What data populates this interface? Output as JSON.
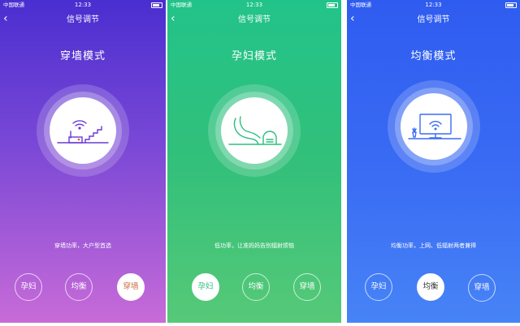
{
  "status": {
    "carrier": "中国联通",
    "time": "12:33"
  },
  "nav": {
    "title": "信号调节",
    "back": "‹"
  },
  "screens": [
    {
      "mode": "穿墙模式",
      "description": "穿墙功率，大户型首选",
      "buttons": [
        "孕妇",
        "均衡",
        "穿墙"
      ],
      "active": 2
    },
    {
      "mode": "孕妇模式",
      "description": "低功率，让准妈妈告别辐射烦恼",
      "buttons": [
        "孕妇",
        "均衡",
        "穿墙"
      ],
      "active": 0
    },
    {
      "mode": "均衡模式",
      "description": "均衡功率，上网、低辐射两者兼得",
      "buttons": [
        "孕妇",
        "均衡",
        "穿墙"
      ],
      "active": 1
    }
  ],
  "colors": {
    "purple": "#6a3ad2",
    "green": "#2bbf80",
    "blue": "#3a6cf4"
  }
}
